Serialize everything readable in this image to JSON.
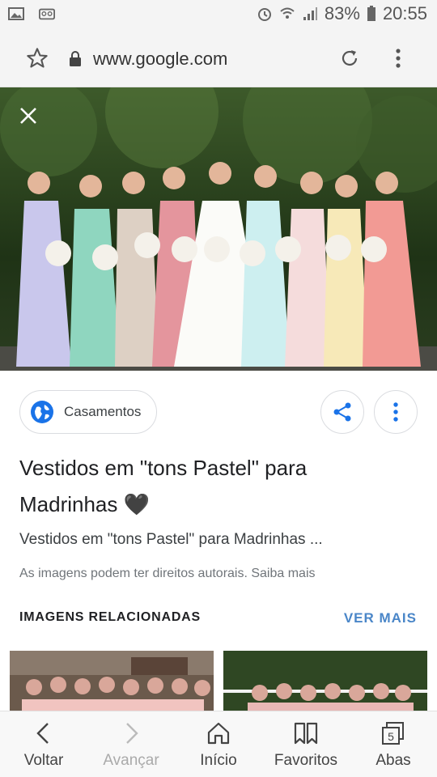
{
  "status_bar": {
    "battery": "83%",
    "time": "20:55"
  },
  "browser": {
    "url": "www.google.com"
  },
  "image_viewer": {
    "source_chip_label": "Casamentos",
    "title": "Vestidos em \"tons Pastel\" para Madrinhas 🖤",
    "subtitle": "Vestidos em \"tons Pastel\" para Madrinhas ...",
    "rights_notice": "As imagens podem ter direitos autorais. Saiba mais"
  },
  "related": {
    "heading": "IMAGENS RELACIONADAS",
    "see_more": "VER MAIS"
  },
  "bottom_nav": [
    {
      "label": "Voltar",
      "icon": "back-icon",
      "enabled": true
    },
    {
      "label": "Avançar",
      "icon": "forward-icon",
      "enabled": false
    },
    {
      "label": "Início",
      "icon": "home-icon",
      "enabled": true
    },
    {
      "label": "Favoritos",
      "icon": "bookmarks-icon",
      "enabled": true
    },
    {
      "label": "Abas",
      "icon": "tabs-icon",
      "enabled": true,
      "badge": "5"
    }
  ],
  "colors": {
    "accent": "#4a86c8",
    "chip_globe": "#1a73e8"
  }
}
